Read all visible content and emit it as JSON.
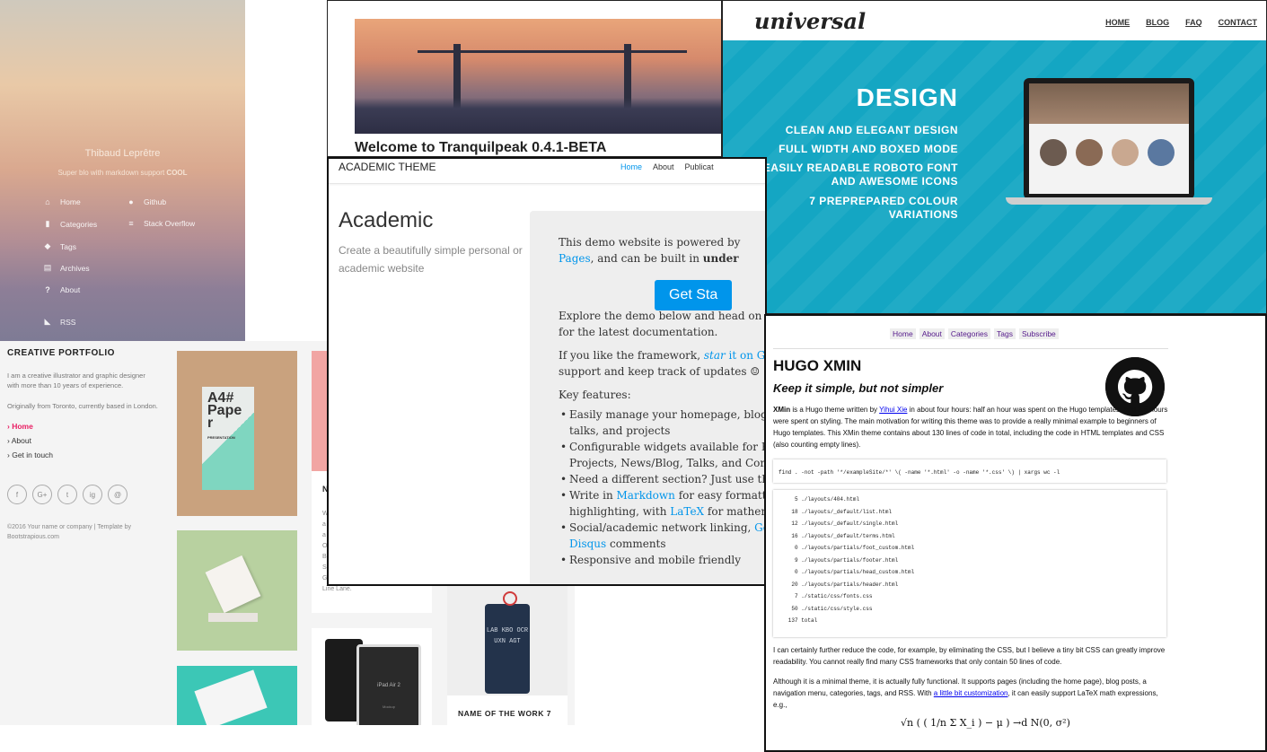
{
  "tranquilpeak_sidebar": {
    "author": "Thibaud Leprêtre",
    "tagline": "Super blo with markdown support",
    "tagline_bold": "COOL",
    "menu": [
      {
        "label": "Home",
        "icon": "home-icon"
      },
      {
        "label": "Categories",
        "icon": "bookmark-icon"
      },
      {
        "label": "Tags",
        "icon": "tags-icon"
      },
      {
        "label": "Archives",
        "icon": "archive-icon"
      },
      {
        "label": "About",
        "icon": "question-icon"
      },
      {
        "label": "RSS",
        "icon": "rss-icon"
      }
    ],
    "links": [
      {
        "label": "Github",
        "icon": "github-icon"
      },
      {
        "label": "Stack Overflow",
        "icon": "stackoverflow-icon"
      }
    ]
  },
  "tranquilpeak_post": {
    "title": "Welcome to Tranquilpeak 0.4.1-BETA"
  },
  "universal": {
    "logo": "universal",
    "nav": [
      "HOME",
      "BLOG",
      "FAQ",
      "CONTACT"
    ],
    "heading": "DESIGN",
    "features": [
      "CLEAN AND ELEGANT DESIGN",
      "FULL WIDTH AND BOXED MODE",
      "EASILY READABLE ROBOTO FONT AND AWESOME ICONS",
      "7 PREPREPARED COLOUR VARIATIONS"
    ],
    "accent": "#14a6c3"
  },
  "portfolio": {
    "title": "CREATIVE PORTFOLIO",
    "intro": "I am a creative illustrator and graphic designer with more than 10 years of experience.",
    "origin": "Originally from Toronto, currently based in London.",
    "nav": [
      {
        "label": "Home",
        "active": true
      },
      {
        "label": "About",
        "active": false
      },
      {
        "label": "Get in touch",
        "active": false
      }
    ],
    "social": [
      "f",
      "G+",
      "t",
      "ig",
      "@"
    ],
    "copyright": "©2016 Your name or company | Template by Bootstrapious.com",
    "card_work_7": "NAME OF THE WORK 7",
    "card_partial": "N",
    "paper_text": "A4# Pape r",
    "paper_sub": "PRESENTATION",
    "ipad_text": "iPad Air 2",
    "ipad_sub": "Mockup",
    "tag_letters": "LAB KBO OCR UXN AGT",
    "partial_text_lines": [
      "W",
      "a",
      "a",
      "O",
      "B",
      "S",
      "G"
    ],
    "partial_tail": "Line Lane.",
    "accent": "#e91e63"
  },
  "academic": {
    "brand": "ACADEMIC THEME",
    "nav": [
      "Home",
      "About",
      "Publicat"
    ],
    "heading": "Academic",
    "subtitle": "Create a beautifully simple personal or academic website",
    "p1_a": "This demo website is powered by",
    "p1_link": "Pages",
    "p1_b": ", and can be built in",
    "p1_bold": "under",
    "button": "Get Sta",
    "p2": [
      "Explore the demo below and head on over",
      "for the latest documentation."
    ],
    "p3_a": "If you like the framework,",
    "p3_star": "star",
    "p3_link": "it on Githu",
    "p3_b": "support and keep track of updates ☺",
    "key_features": "Key features:",
    "features": [
      {
        "text": "Easily manage your homepage, blog p",
        "cont": "talks, and projects"
      },
      {
        "text": "Configurable widgets available for Bio",
        "cont": "Projects, News/Blog, Talks, and Conta"
      },
      {
        "text": "Need a different section? Just use the",
        "cont": ""
      },
      {
        "text": "Write in",
        "link": "Markdown",
        "after": "for easy formattin",
        "cont": "highlighting, with",
        "cont_link": "LaTeX",
        "cont_after": "for mathema"
      },
      {
        "text": "Social/academic network linking,",
        "link": "Goog",
        "cont_link": "Disqus",
        "cont_after": "comments"
      },
      {
        "text": "Responsive and mobile friendly",
        "cont": ""
      }
    ],
    "accent": "#0095eb"
  },
  "xmin": {
    "menu": [
      "Home",
      "About",
      "Categories",
      "Tags",
      "Subscribe"
    ],
    "title": "HUGO XMIN",
    "subtitle": "Keep it simple, but not simpler",
    "intro_bold": "XMin",
    "intro_a": "is a Hugo theme written by",
    "intro_link": "Yihui Xie",
    "intro_b": "in about four hours: half an hour was spent on the Hugo templates, and 3.5 hours were spent on styling. The main motivation for writing this theme was to provide a really minimal example to beginners of Hugo templates. This XMin theme contains about 130 lines of code in total, including the code in HTML templates and CSS (also counting empty lines).",
    "command": "find . -not -path '*/exampleSite/*' \\( -name '*.html' -o -name '*.css' \\) | xargs wc -l",
    "output": [
      "     5 ./layouts/404.html",
      "    18 ./layouts/_default/list.html",
      "    12 ./layouts/_default/single.html",
      "    16 ./layouts/_default/terms.html",
      "     0 ./layouts/partials/foot_custom.html",
      "     9 ./layouts/partials/footer.html",
      "     0 ./layouts/partials/head_custom.html",
      "    20 ./layouts/partials/header.html",
      "     7 ./static/css/fonts.css",
      "    50 ./static/css/style.css",
      "   137 total"
    ],
    "para2": "I can certainly further reduce the code, for example, by eliminating the CSS, but I believe a tiny bit CSS can greatly improve readability. You cannot really find many CSS frameworks that only contain 50 lines of code.",
    "para3_a": "Although it is a minimal theme, it is actually fully functional. It supports pages (including the home page), blog posts, a navigation menu, categories, tags, and RSS. With",
    "para3_link": "a little bit customization",
    "para3_b": ", it can easily support LaTeX math expressions, e.g.,",
    "math": "√n ( ( 1/n Σ X_i ) − μ ) →d N(0, σ²)"
  }
}
